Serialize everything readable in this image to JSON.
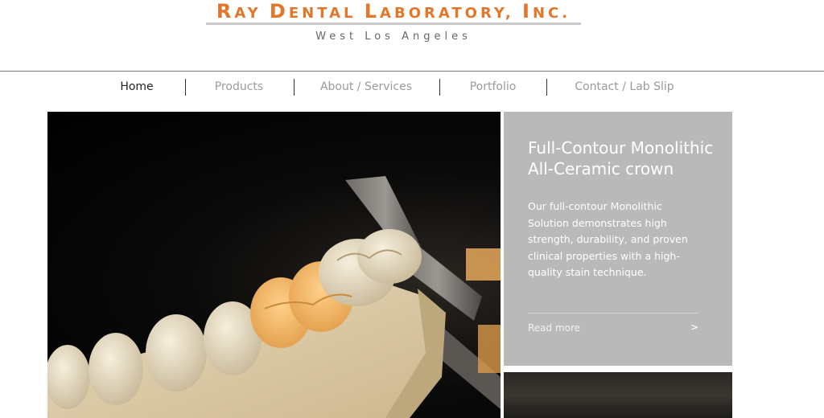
{
  "brand": {
    "logo": {
      "w1_cap": "R",
      "w1_rest": "AY ",
      "w2_cap": "D",
      "w2_rest": "ENTAL ",
      "w3_cap": "L",
      "w3_rest": "ABORATORY, ",
      "w4_cap": "I",
      "w4_rest": "NC."
    },
    "subtitle": "West Los Angeles",
    "accent_color": "#e2762a"
  },
  "nav": {
    "items": [
      {
        "label": "Home",
        "active": true
      },
      {
        "label": "Products",
        "active": false
      },
      {
        "label": "About / Services",
        "active": false
      },
      {
        "label": "Portfolio",
        "active": false
      },
      {
        "label": "Contact / Lab Slip",
        "active": false
      }
    ]
  },
  "hero": {
    "image": "dental-model-photo"
  },
  "card": {
    "title": "Full-Contour Monolithic All-Ceramic crown",
    "text": "Our full-contour Monolithic Solution demonstrates high strength, durability, and proven clinical properties with a high-quality stain technique.",
    "read_more": "Read more",
    "arrow": ">",
    "background": "#b9b9b9"
  }
}
